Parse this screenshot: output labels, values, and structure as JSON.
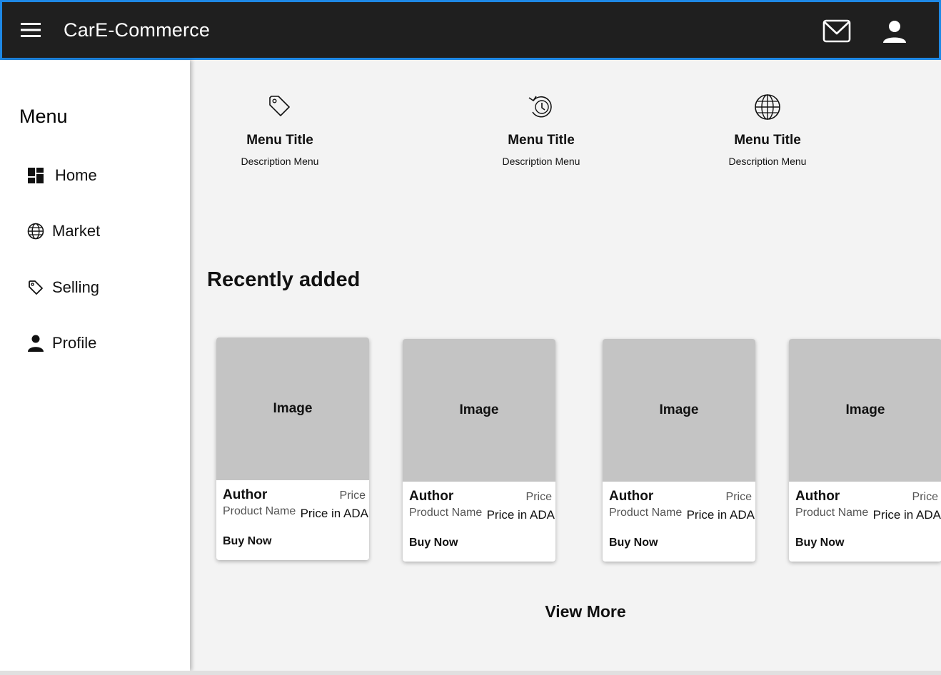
{
  "header": {
    "title": "CarE-Commerce",
    "menu_icon": "hamburger-menu-icon",
    "mail_icon": "mail-icon",
    "account_icon": "account-icon"
  },
  "sidebar": {
    "heading": "Menu",
    "items": [
      {
        "label": "Home",
        "icon": "dashboard-icon"
      },
      {
        "label": "Market",
        "icon": "globe-icon"
      },
      {
        "label": "Selling",
        "icon": "tag-icon"
      },
      {
        "label": "Profile",
        "icon": "person-icon"
      }
    ]
  },
  "features": [
    {
      "title": "Menu Title",
      "description": "Description Menu",
      "icon": "tag-icon"
    },
    {
      "title": "Menu Title",
      "description": "Description Menu",
      "icon": "history-icon"
    },
    {
      "title": "Menu Title",
      "description": "Description Menu",
      "icon": "globe-icon"
    }
  ],
  "recent": {
    "title": "Recently added",
    "cards": [
      {
        "image": "Image",
        "author": "Author",
        "price_label": "Price",
        "product_name": "Product Name",
        "price_value": "Price in ADA",
        "buy": "Buy Now"
      },
      {
        "image": "Image",
        "author": "Author",
        "price_label": "Price",
        "product_name": "Product Name",
        "price_value": "Price in ADA",
        "buy": "Buy Now"
      },
      {
        "image": "Image",
        "author": "Author",
        "price_label": "Price",
        "product_name": "Product Name",
        "price_value": "Price in ADA",
        "buy": "Buy Now"
      },
      {
        "image": "Image",
        "author": "Author",
        "price_label": "Price",
        "product_name": "Product Name",
        "price_value": "Price in ADA",
        "buy": "Buy Now"
      }
    ],
    "view_more": "View More"
  },
  "colors": {
    "appbar_bg": "#1f1f1f",
    "appbar_border": "#1e88e5",
    "page_bg": "#f3f3f3",
    "image_placeholder": "#c4c4c4"
  }
}
